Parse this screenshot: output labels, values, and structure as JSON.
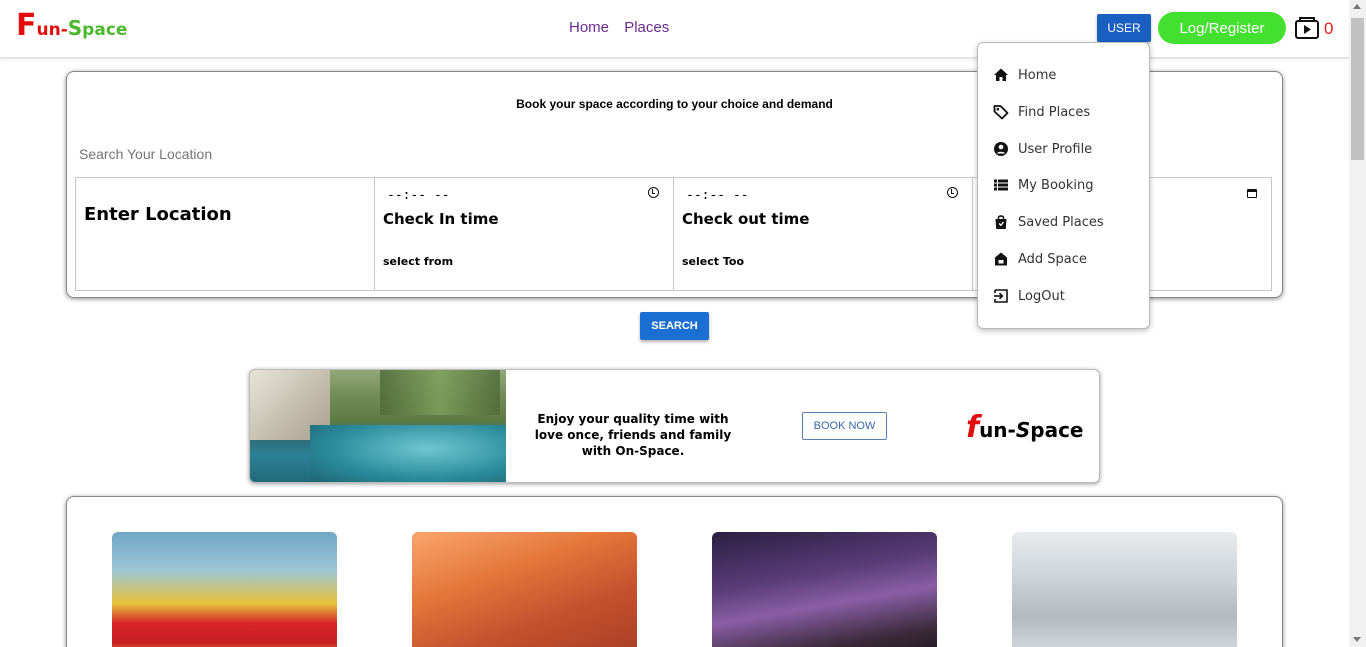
{
  "header": {
    "logo": {
      "f": "F",
      "un": "un-",
      "s": "S",
      "pace": "pace"
    },
    "nav": [
      "Home",
      "Places"
    ],
    "user_button": "USER",
    "login_button": "Log/Register",
    "cart_count": "0"
  },
  "menu": {
    "items": [
      {
        "label": "Home",
        "icon": "home-icon"
      },
      {
        "label": "Find Places",
        "icon": "tag-icon"
      },
      {
        "label": "User Profile",
        "icon": "user-circle-icon"
      },
      {
        "label": "My Booking",
        "icon": "list-icon"
      },
      {
        "label": "Saved Places",
        "icon": "shopping-bag-icon"
      },
      {
        "label": "Add Space",
        "icon": "add-home-icon"
      },
      {
        "label": "LogOut",
        "icon": "logout-icon"
      }
    ]
  },
  "search": {
    "heading": "Book your space according to your choice and demand",
    "location_placeholder": "Search Your Location",
    "location_label": "Enter Location",
    "checkin": {
      "value": "--:-- --",
      "label": "Check In time",
      "sub": "select from"
    },
    "checkout": {
      "value": "--:-- --",
      "label": "Check out time",
      "sub": "select Too"
    },
    "button": "SEARCH"
  },
  "banner": {
    "text": "Enjoy your quality time with love once, friends and family with On-Space.",
    "button": "BOOK NOW",
    "logo_f": "f",
    "logo_rest": "un-",
    "logo_s": "S",
    "logo_pace": "pace"
  },
  "colors": {
    "brand_red": "#e10d0d",
    "brand_green": "#4cb82c",
    "nav_purple": "#6a2c8f",
    "user_blue": "#1a5fc2",
    "login_green": "#44e030"
  }
}
